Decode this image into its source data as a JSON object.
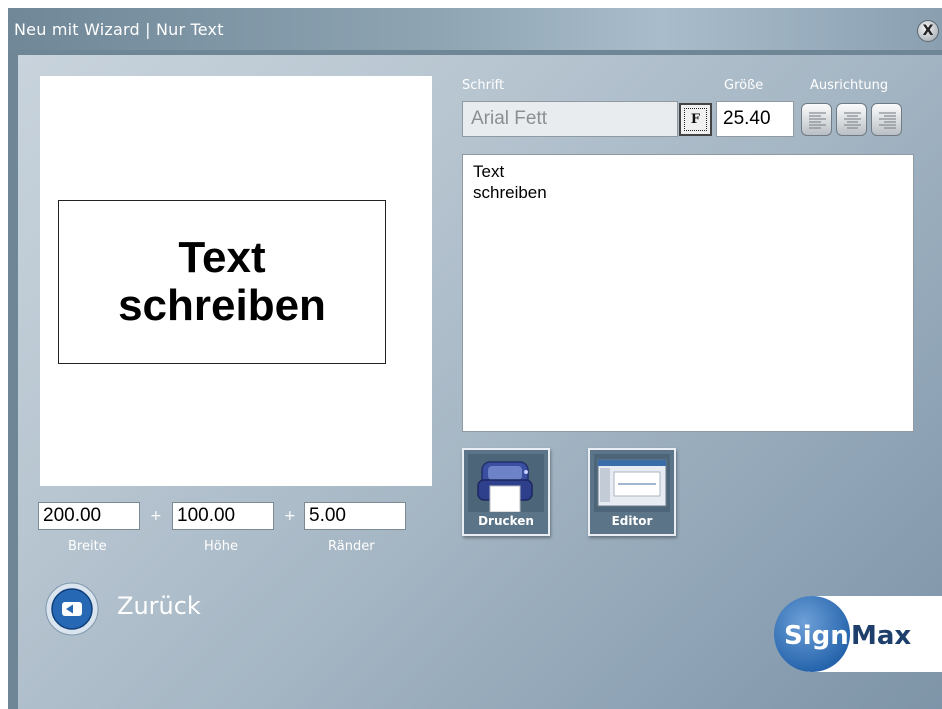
{
  "window": {
    "title": "Neu mit Wizard | Nur Text",
    "close_label": "X"
  },
  "preview": {
    "lines": [
      "Text",
      "schreiben"
    ]
  },
  "dimensions": {
    "width_value": "200.00",
    "height_value": "100.00",
    "margin_value": "5.00",
    "plus_1": "+",
    "plus_2": "+",
    "width_label": "Breite",
    "height_label": "Höhe",
    "margin_label": "Ränder"
  },
  "font": {
    "label": "Schrift",
    "value": "Arial Fett",
    "button_label": "F"
  },
  "size": {
    "label": "Größe",
    "value": "25.40"
  },
  "alignment": {
    "label": "Ausrichtung",
    "options": [
      "align-left-icon",
      "align-center-icon",
      "align-right-icon"
    ]
  },
  "text_editor": {
    "lines": [
      "Text",
      "schreiben"
    ]
  },
  "actions": {
    "print_label": "Drucken",
    "editor_label": "Editor"
  },
  "back": {
    "label": "Zurück"
  },
  "logo": {
    "part1": "Sign",
    "part2": "Max"
  },
  "colors": {
    "title_bar": "#8ea4b3",
    "panel": "#a5b6c4",
    "logo_blue": "#1f5fa8",
    "logo_text": "#1e3f6b"
  }
}
